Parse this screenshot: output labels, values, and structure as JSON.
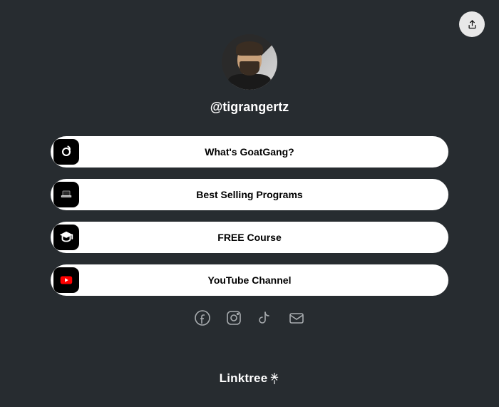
{
  "username": "@tigrangertz",
  "links": [
    {
      "label": "What's GoatGang?",
      "icon": "goat"
    },
    {
      "label": "Best Selling Programs",
      "icon": "laptop"
    },
    {
      "label": "FREE Course",
      "icon": "graduation"
    },
    {
      "label": "YouTube Channel",
      "icon": "youtube"
    }
  ],
  "socials": [
    "facebook",
    "instagram",
    "tiktok",
    "email"
  ],
  "footer": "Linktree"
}
